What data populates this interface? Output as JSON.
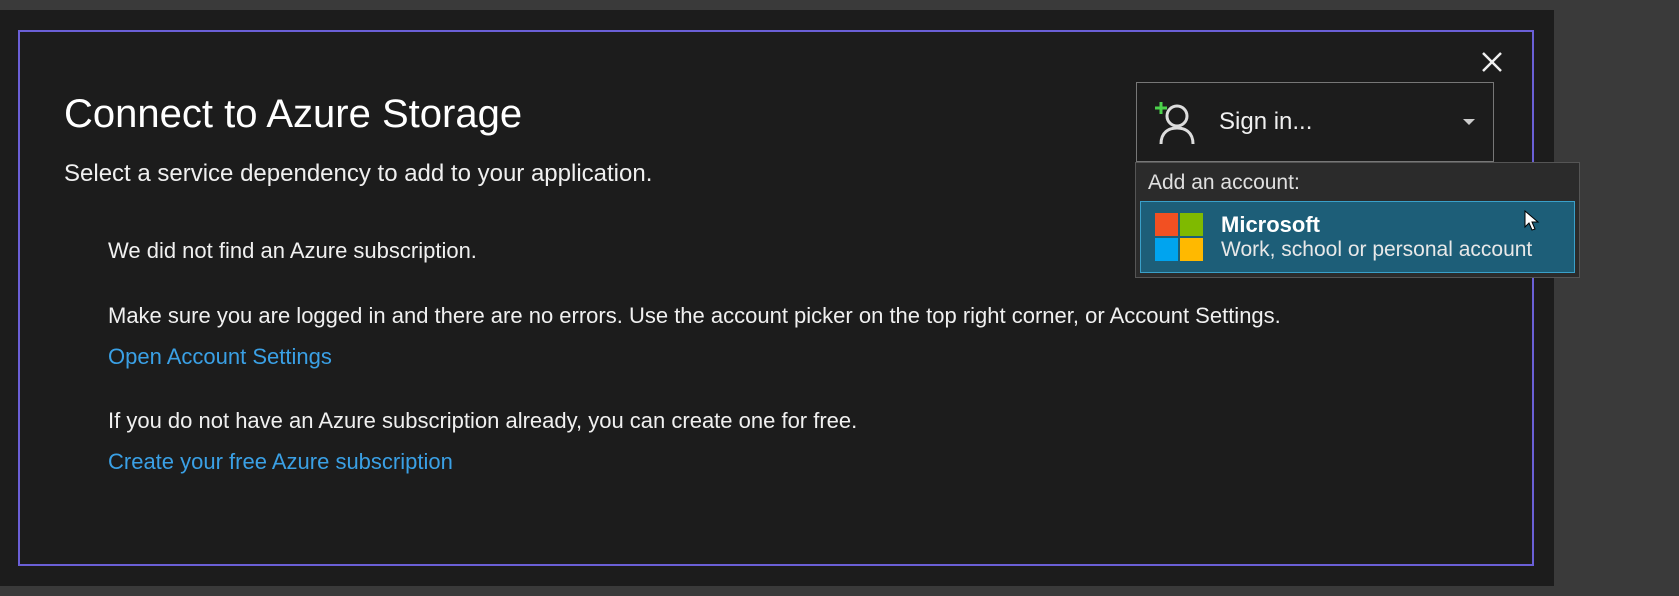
{
  "dialog": {
    "title": "Connect to Azure Storage",
    "subtitle": "Select a service dependency to add to your application.",
    "no_subscription": "We did not find an Azure subscription.",
    "instructions": "Make sure you are logged in and there are no errors. Use the account picker on the top right corner, or Account Settings.",
    "open_settings_link": "Open Account Settings",
    "no_azure": "If you do not have an Azure subscription already, you can create one for free.",
    "create_link": "Create your free Azure subscription"
  },
  "signin": {
    "label": "Sign in..."
  },
  "dropdown": {
    "header": "Add an account:",
    "item": {
      "name": "Microsoft",
      "desc": "Work, school or personal account"
    }
  }
}
